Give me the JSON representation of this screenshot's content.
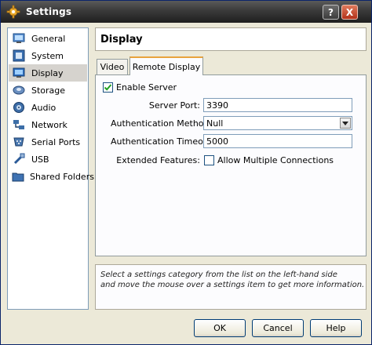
{
  "window": {
    "title": "Settings",
    "help_button": "?",
    "close_button": "X"
  },
  "sidebar": {
    "items": [
      {
        "label": "General",
        "icon": "monitor-icon"
      },
      {
        "label": "System",
        "icon": "chip-icon"
      },
      {
        "label": "Display",
        "icon": "display-icon",
        "selected": true
      },
      {
        "label": "Storage",
        "icon": "disk-icon"
      },
      {
        "label": "Audio",
        "icon": "speaker-icon"
      },
      {
        "label": "Network",
        "icon": "network-icon"
      },
      {
        "label": "Serial Ports",
        "icon": "serial-port-icon"
      },
      {
        "label": "USB",
        "icon": "usb-icon"
      },
      {
        "label": "Shared Folders",
        "icon": "folder-icon"
      }
    ]
  },
  "page": {
    "title": "Display"
  },
  "tabs": [
    {
      "label": "Video",
      "selected": false
    },
    {
      "label": "Remote Display",
      "selected": true
    }
  ],
  "remote_display": {
    "enable_server": {
      "label": "Enable Server",
      "checked": true
    },
    "server_port": {
      "label": "Server Port:",
      "value": "3390"
    },
    "auth_method": {
      "label": "Authentication Method:",
      "value": "Null"
    },
    "auth_timeout": {
      "label": "Authentication Timeout:",
      "value": "5000"
    },
    "extended_features": {
      "label": "Extended Features:"
    },
    "allow_multiple": {
      "label": "Allow Multiple Connections",
      "checked": false
    }
  },
  "info": {
    "line1": "Select a settings category from the list on the left-hand side",
    "line2": "and move the mouse over a settings item to get more information."
  },
  "buttons": {
    "ok": "OK",
    "cancel": "Cancel",
    "help": "Help"
  },
  "colors": {
    "accent": "#e8a33d",
    "selection": "#d6d3ce",
    "titlebar": "#3a3a3a"
  }
}
